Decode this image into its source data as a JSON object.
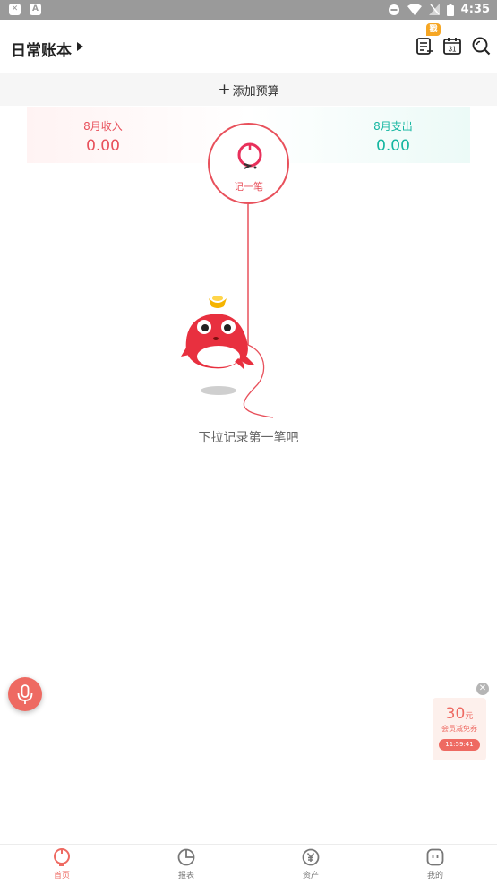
{
  "status_bar": {
    "time": "4:35"
  },
  "header": {
    "book_title": "日常账本",
    "badge": "戳",
    "icons": [
      "bill-list-icon",
      "calendar-icon",
      "search-icon"
    ],
    "calendar_day": "31"
  },
  "budget": {
    "plus": "+",
    "label": "添加预算"
  },
  "summary": {
    "income_label": "8月收入",
    "income_value": "0.00",
    "expense_label": "8月支出",
    "expense_value": "0.00"
  },
  "record": {
    "label": "记一笔"
  },
  "empty_hint": "下拉记录第一笔吧",
  "coupon": {
    "amount": "30",
    "unit": "元",
    "desc": "会员减免券",
    "timer": "11:59:41"
  },
  "nav": {
    "items": [
      {
        "label": "首页",
        "icon": "home-icon",
        "active": true
      },
      {
        "label": "报表",
        "icon": "pie-chart-icon",
        "active": false
      },
      {
        "label": "资产",
        "icon": "yen-icon",
        "active": false
      },
      {
        "label": "我的",
        "icon": "profile-icon",
        "active": false
      }
    ]
  },
  "colors": {
    "accent": "#ee6a62",
    "income": "#e8505b",
    "expense": "#14b6a1",
    "badge": "#f6a623"
  }
}
